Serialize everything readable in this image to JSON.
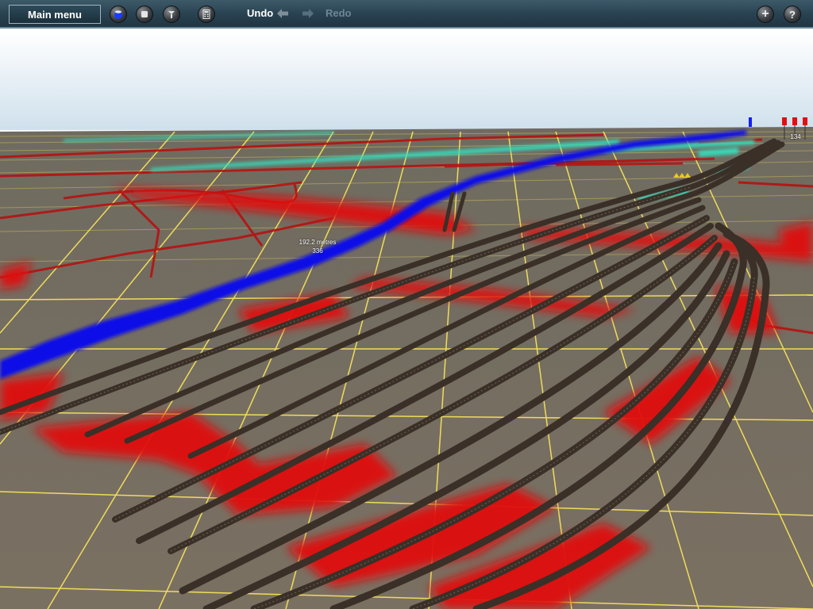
{
  "toolbar": {
    "main_menu_label": "Main menu",
    "undo_label": "Undo",
    "redo_label": "Redo",
    "left_icons": [
      "blue-orb-icon",
      "stop-icon",
      "help-query-icon",
      "calculator-icon"
    ],
    "right_icons": [
      "plus-icon",
      "question-icon"
    ]
  },
  "viewport": {
    "measure_distance": "192.2 metres",
    "measure_value": "336",
    "marker_number": "134"
  },
  "colors": {
    "toolbar_bg": "#2a4352",
    "ground": "#7a7060",
    "grid": "#e8d86a",
    "red_overlay": "#e01010",
    "blue_overlay": "#1010e8",
    "cyan_overlay": "#30e0c0",
    "track": "#3a3028",
    "sky_top": "#ffffff",
    "sky_bottom": "#cfe0ec"
  }
}
